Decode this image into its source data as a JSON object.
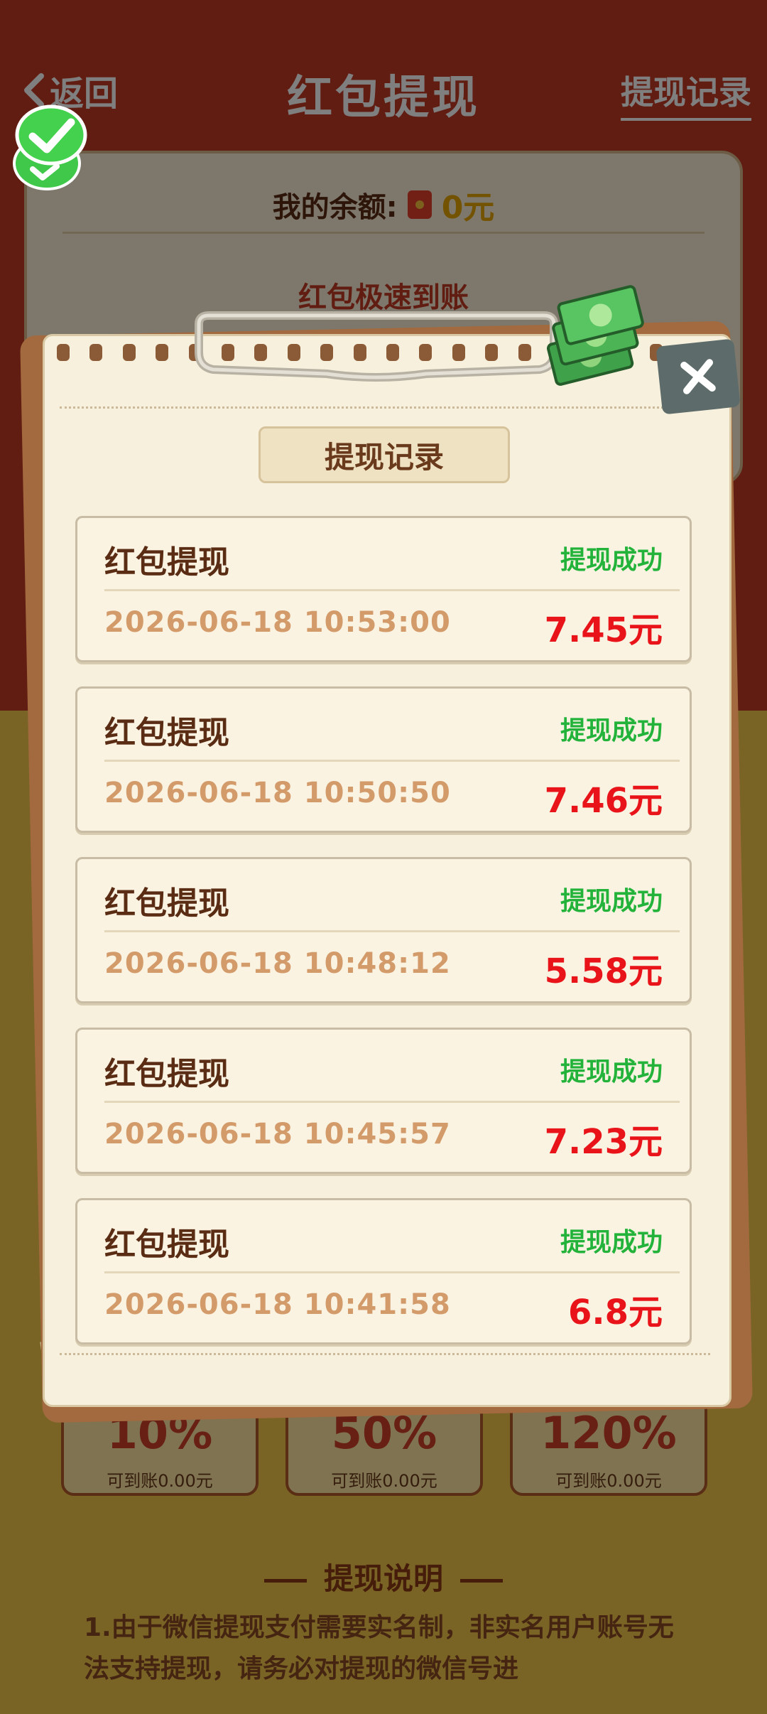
{
  "header": {
    "back_label": "返回",
    "title": "红包提现",
    "records_link": "提现记录"
  },
  "balance": {
    "label": "我的余额:",
    "value": "0元",
    "fast_label": "红包极速到账"
  },
  "options": [
    {
      "pct": "10%",
      "sub": "可到账0.00元"
    },
    {
      "pct": "50%",
      "sub": "可到账0.00元"
    },
    {
      "pct": "120%",
      "sub": "可到账0.00元"
    }
  ],
  "description": {
    "title": "提现说明",
    "text": "1.由于微信提现支付需要实名制，非实名用户账号无法支持提现，请务必对提现的微信号进"
  },
  "modal": {
    "title": "提现记录",
    "records": [
      {
        "type": "红包提现",
        "status": "提现成功",
        "time": "2026-06-18 10:53:00",
        "amount": "7.45元"
      },
      {
        "type": "红包提现",
        "status": "提现成功",
        "time": "2026-06-18 10:50:50",
        "amount": "7.46元"
      },
      {
        "type": "红包提现",
        "status": "提现成功",
        "time": "2026-06-18 10:48:12",
        "amount": "5.58元"
      },
      {
        "type": "红包提现",
        "status": "提现成功",
        "time": "2026-06-18 10:45:57",
        "amount": "7.23元"
      },
      {
        "type": "红包提现",
        "status": "提现成功",
        "time": "2026-06-18 10:41:58",
        "amount": "6.8元"
      }
    ]
  },
  "colors": {
    "header_red": "#c33a24",
    "status_green": "#23b33a",
    "amount_red": "#e8141a",
    "paper": "#f7f0dd"
  }
}
